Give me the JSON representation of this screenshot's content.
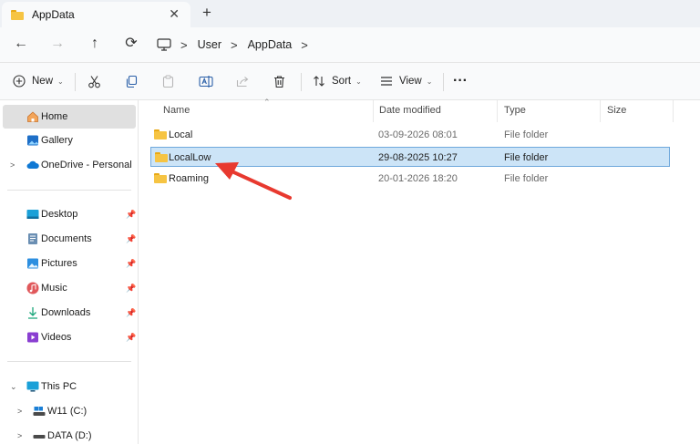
{
  "tab": {
    "title": "AppData",
    "close": "✕",
    "new": "+"
  },
  "nav": {
    "back": "←",
    "forward": "→",
    "up": "↑",
    "refresh": "⟳",
    "breadcrumbs": [
      "User",
      "AppData"
    ]
  },
  "toolbar": {
    "new_label": "New",
    "sort_label": "Sort",
    "view_label": "View",
    "more": "···"
  },
  "sidebar": {
    "items": [
      {
        "label": "Home"
      },
      {
        "label": "Gallery"
      },
      {
        "label": "OneDrive - Personal"
      },
      {
        "label": "Desktop"
      },
      {
        "label": "Documents"
      },
      {
        "label": "Pictures"
      },
      {
        "label": "Music"
      },
      {
        "label": "Downloads"
      },
      {
        "label": "Videos"
      },
      {
        "label": "This PC"
      },
      {
        "label": "W11 (C:)"
      },
      {
        "label": "DATA (D:)"
      }
    ]
  },
  "columns": {
    "name": "Name",
    "date": "Date modified",
    "type": "Type",
    "size": "Size"
  },
  "files": [
    {
      "name": "Local",
      "date": "03-09-2026 08:01",
      "type": "File folder"
    },
    {
      "name": "LocalLow",
      "date": "29-08-2025 10:27",
      "type": "File folder"
    },
    {
      "name": "Roaming",
      "date": "20-01-2026 18:20",
      "type": "File folder"
    }
  ],
  "colors": {
    "selection": "#cce4f7",
    "selection_border": "#6fa8dc",
    "folder": "#f6c443",
    "annotation_arrow": "#e8392f"
  }
}
